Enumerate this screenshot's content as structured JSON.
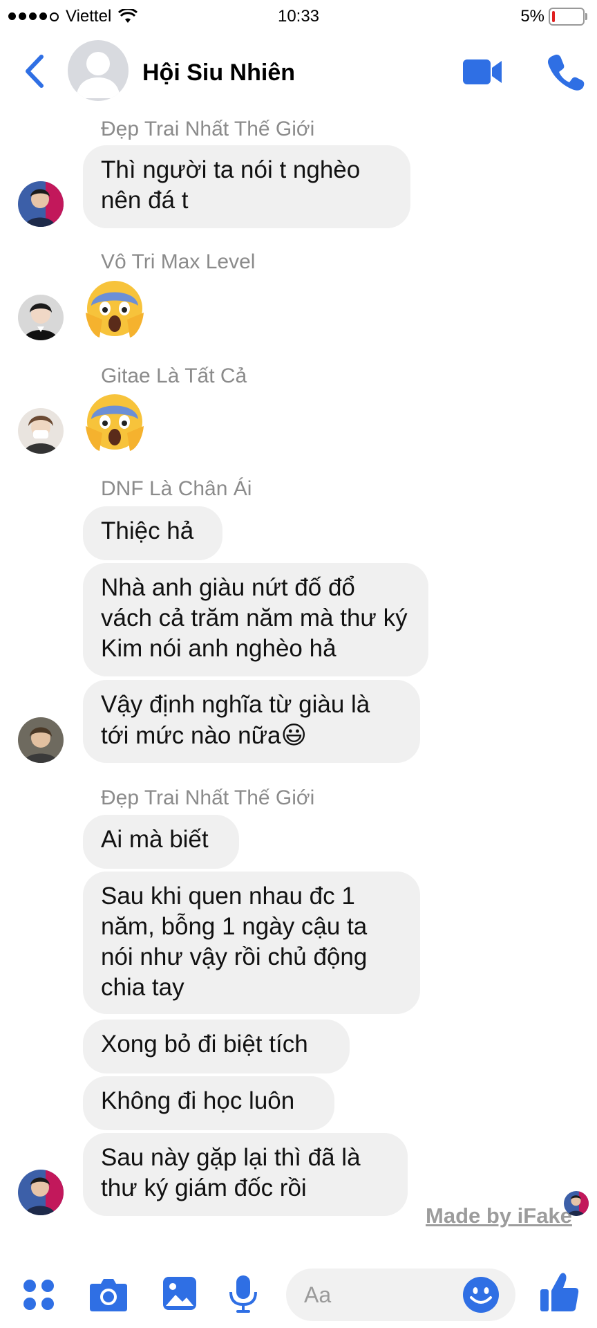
{
  "status_bar": {
    "carrier": "Viettel",
    "time": "10:33",
    "battery": "5%"
  },
  "header": {
    "title": "Hội Siu Nhiên",
    "accent": "#2f6fe4"
  },
  "messages": {
    "m1": {
      "sender": "Đẹp Trai Nhất Thế Giới",
      "text": "Thì người ta nói t nghèo nên đá t"
    },
    "m2": {
      "sender": "Vô Tri Max Level",
      "emoji": "😱"
    },
    "m3": {
      "sender": "Gitae Là Tất Cả",
      "emoji": "😱"
    },
    "m4": {
      "sender": "DNF Là Chân Ái",
      "b1": "Thiệc hả",
      "b2": "Nhà anh giàu nứt đố đổ vách cả trăm năm mà thư ký Kim nói anh nghèo hả",
      "b3": "Vậy định nghĩa từ giàu là tới mức nào nữa",
      "b3_emoji": "😃"
    },
    "m5": {
      "sender": "Đẹp Trai Nhất Thế Giới",
      "b1": "Ai mà biết",
      "b2": "Sau khi quen nhau đc 1 năm, bỗng 1 ngày cậu ta nói như vậy rồi chủ động chia tay",
      "b3": "Xong bỏ đi biệt tích",
      "b4": "Không đi học luôn",
      "b5": "Sau này gặp lại thì đã là thư ký giám đốc rồi"
    }
  },
  "watermark": "Made by iFake",
  "composer": {
    "placeholder": "Aa",
    "icons": [
      "apps-icon",
      "camera-icon",
      "photo-icon",
      "microphone-icon",
      "emoji-icon",
      "like-icon"
    ]
  }
}
